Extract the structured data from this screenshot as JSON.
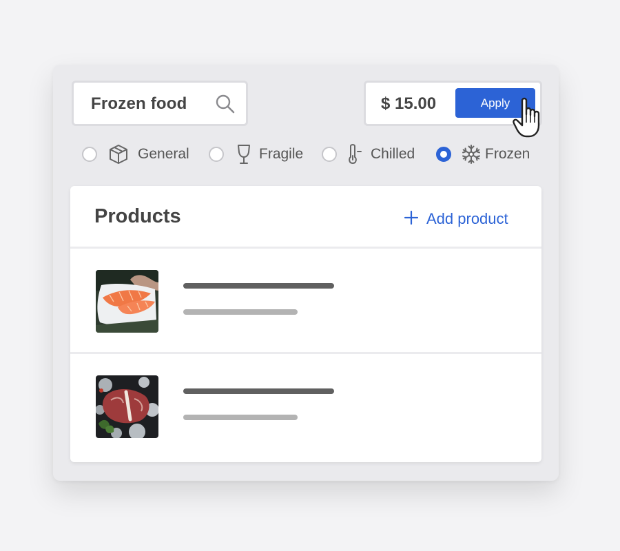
{
  "search": {
    "value": "Frozen food",
    "icon": "search-icon"
  },
  "price_filter": {
    "value": "$ 15.00",
    "apply_label": "Apply"
  },
  "categories": [
    {
      "label": "General",
      "icon": "box-icon",
      "selected": false
    },
    {
      "label": "Fragile",
      "icon": "wine-glass-icon",
      "selected": false
    },
    {
      "label": "Chilled",
      "icon": "thermometer-icon",
      "selected": false
    },
    {
      "label": "Frozen",
      "icon": "snowflake-icon",
      "selected": true
    }
  ],
  "products": {
    "title": "Products",
    "add_label": "Add product",
    "items": [
      {
        "image": "salmon-fillet-image"
      },
      {
        "image": "t-bone-steak-image"
      }
    ]
  },
  "colors": {
    "accent": "#2c63d6",
    "text": "#444444",
    "panel": "#eaeaed",
    "background": "#f3f3f5"
  }
}
